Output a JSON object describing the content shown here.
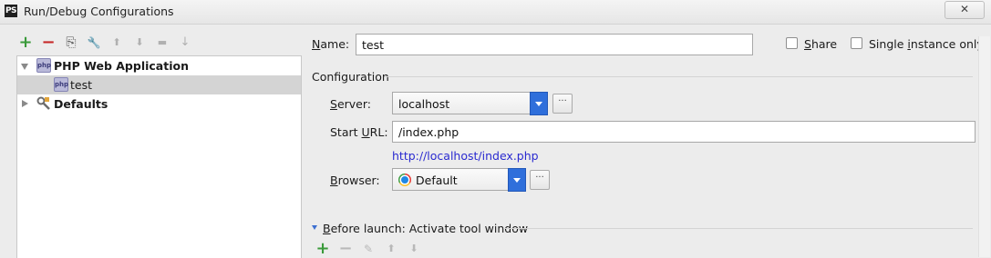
{
  "window": {
    "app_badge": "PS",
    "title": "Run/Debug Configurations",
    "close_label": "✕"
  },
  "left_toolbar": {
    "buttons": [
      {
        "name": "add",
        "glyph": "+",
        "color": "#3a9a3a"
      },
      {
        "name": "remove",
        "glyph": "−",
        "color": "#c62828"
      },
      {
        "name": "copy",
        "glyph": "⎘",
        "color": "#555555"
      },
      {
        "name": "edit-defaults",
        "glyph": "🔧",
        "color": "#666666"
      },
      {
        "name": "move-up",
        "glyph": "⬆",
        "color": "#b0b0b0"
      },
      {
        "name": "move-down",
        "glyph": "⬇",
        "color": "#b0b0b0"
      },
      {
        "name": "folder",
        "glyph": "▬",
        "color": "#b0b0b0"
      },
      {
        "name": "sort",
        "glyph": "↓",
        "color": "#b0b0b0"
      }
    ]
  },
  "tree": {
    "items": [
      {
        "label": "PHP Web Application",
        "level": 0,
        "expanded": true,
        "bold": true,
        "icon": "php-icon"
      },
      {
        "label": "test",
        "level": 1,
        "selected": true,
        "icon": "php-icon"
      },
      {
        "label": "Defaults",
        "level": 0,
        "expanded": false,
        "bold": true,
        "icon": "wrench-icon"
      }
    ]
  },
  "form": {
    "name_label_u": "N",
    "name_label_rest": "ame:",
    "name_value": "test",
    "share_label_u": "S",
    "share_label_rest": "hare",
    "single_instance_pre": "Single ",
    "single_instance_u": "i",
    "single_instance_post": "nstance only",
    "configuration_heading": "Configuration",
    "server_label_u": "S",
    "server_label_rest": "erver:",
    "server_value": "localhost",
    "start_url_pre": "Start ",
    "start_url_u": "U",
    "start_url_post": "RL:",
    "start_url_value": "/index.php",
    "resolved_url": "http://localhost/index.php",
    "browser_label_u": "B",
    "browser_label_rest": "rowser:",
    "browser_value": "Default",
    "dots": "···",
    "before_launch_u": "B",
    "before_launch_rest": "efore launch: Activate tool window"
  },
  "before_launch_toolbar": {
    "buttons": [
      {
        "name": "add",
        "glyph": "+",
        "color": "#3a9a3a"
      },
      {
        "name": "remove",
        "glyph": "−",
        "color": "#b8b8b8"
      },
      {
        "name": "edit",
        "glyph": "✎",
        "color": "#b8b8b8"
      },
      {
        "name": "move-up",
        "glyph": "⬆",
        "color": "#b8b8b8"
      },
      {
        "name": "move-down",
        "glyph": "⬇",
        "color": "#b8b8b8"
      }
    ]
  }
}
